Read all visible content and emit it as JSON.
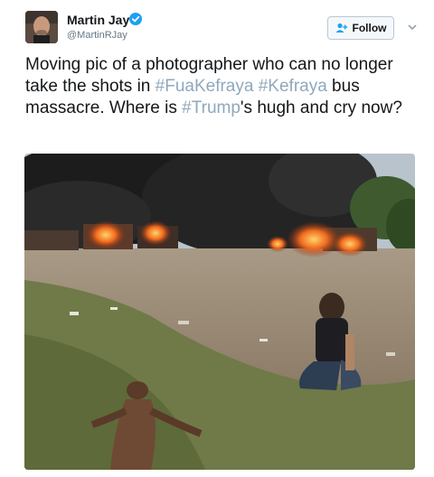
{
  "author": {
    "name": "Martin Jay",
    "handle": "@MartinRJay",
    "verified": true
  },
  "follow_button": {
    "label": "Follow",
    "icon": "add-user-icon"
  },
  "menu": {
    "icon": "chevron-down-icon"
  },
  "tweet": {
    "t1": "Moving pic of a photographer who can no longer take the shots in ",
    "h1": "#FuaKefraya",
    "t2": " ",
    "h2": "#Kefraya",
    "t3": " bus massacre. Where is ",
    "h3": "#Trump",
    "t4": "'s hugh and cry now?"
  },
  "colors": {
    "text": "#14171a",
    "secondary": "#657786",
    "hashtag": "#8fa8bc",
    "verified": "#1da1f2"
  }
}
